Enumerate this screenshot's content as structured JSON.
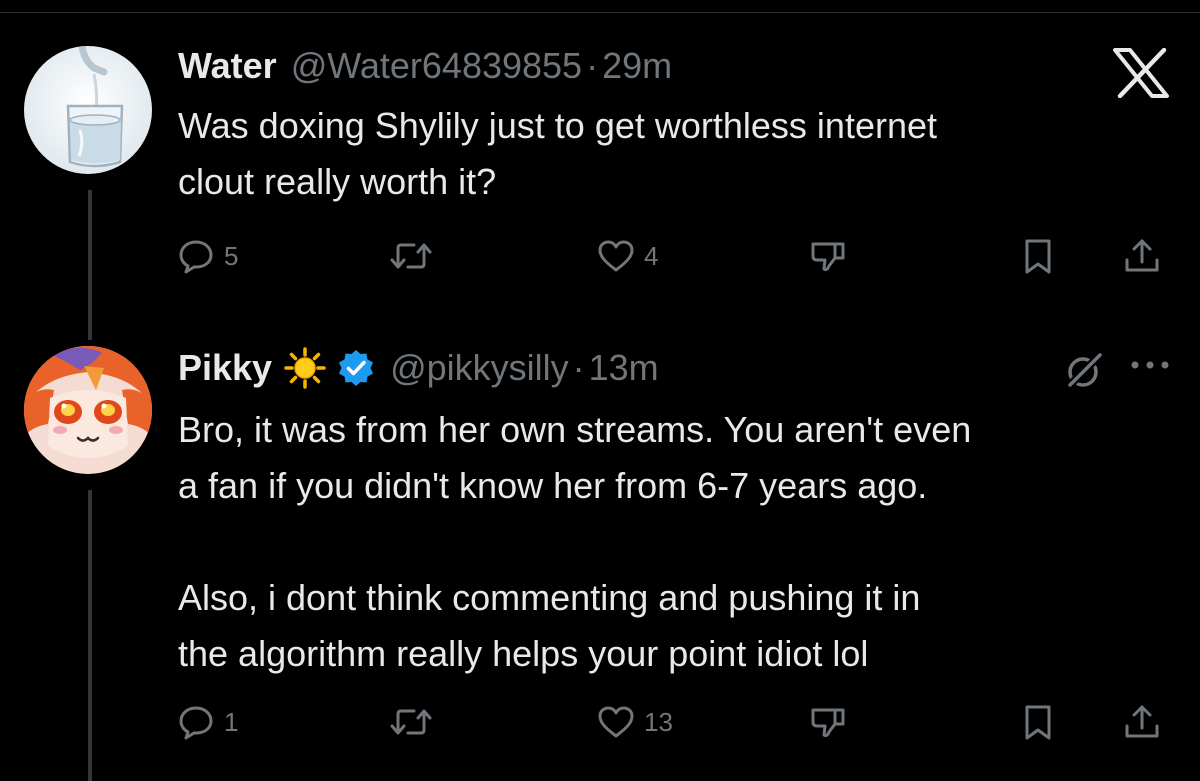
{
  "colors": {
    "background": "#000000",
    "text_primary": "#e7e9ea",
    "text_secondary": "#71767b",
    "verified_blue": "#1d9bf0",
    "thread_line": "#333639"
  },
  "tweets": [
    {
      "name": "Water",
      "handle": "@Water64839855",
      "separator": "·",
      "time": "29m",
      "text": "Was doxing Shylily just to get worthless internet\nclout really worth it?",
      "avatar_icon": "glass-of-water-avatar",
      "actions": {
        "replies": "5",
        "reposts": "",
        "likes": "4"
      }
    },
    {
      "name": "Pikky",
      "emoji": "sun-emoji",
      "verified": true,
      "handle": "@pikkysilly",
      "separator": "·",
      "time": "13m",
      "text": "Bro, it was from her own streams. You aren't even\na fan if you didn't know her from 6-7 years ago.\n\nAlso, i dont think commenting and pushing it in\nthe algorithm really helps your point idiot lol",
      "avatar_icon": "anime-character-avatar",
      "actions": {
        "replies": "1",
        "reposts": "",
        "likes": "13"
      }
    }
  ]
}
